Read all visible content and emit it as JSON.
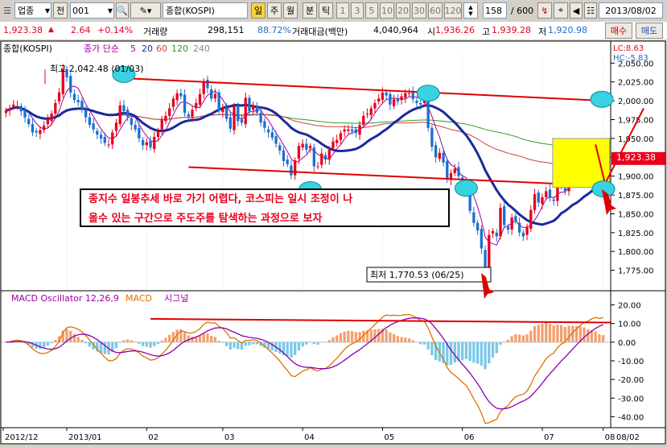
{
  "toolbar": {
    "market_label": "업종",
    "prev_label": "전",
    "code": "001",
    "index_name": "종합(KOSPI)",
    "period_buttons": [
      "일",
      "주",
      "월",
      "분",
      "틱"
    ],
    "minute_buttons": [
      "1",
      "3",
      "5",
      "10",
      "20",
      "30",
      "60",
      "120"
    ],
    "count": "158",
    "count_total": "/ 600",
    "date": "2013/08/02"
  },
  "quote": {
    "price": "1,923.38",
    "change": "2.64",
    "change_pct": "+0.14%",
    "volume_label": "거래량",
    "volume": "298,151",
    "volume_pct": "88.72%",
    "amount_label": "거래대금(백만)",
    "amount": "4,040,964",
    "open_label": "시",
    "open": "1,936.26",
    "high_label": "고",
    "high": "1,939.28",
    "low_label": "저",
    "low": "1,920.98",
    "buy_label": "매수",
    "sell_label": "매도"
  },
  "colors": {
    "up": "#e8001c",
    "down": "#1b6fd0",
    "ma5": "#a000a0",
    "ma20": "#1a2a9a",
    "ma60": "#d04040",
    "ma120": "#2e9a2e",
    "ma240": "#8a8a8a",
    "highlight": "#ffff00",
    "ellipse": "#39d2e0"
  },
  "chart_data": [
    {
      "type": "candlestick",
      "title": "종합(KOSPI)",
      "legend": [
        "종가 단순",
        "5",
        "20",
        "60",
        "120",
        "240"
      ],
      "right_labels": {
        "lc": "LC:8.63",
        "hc": "HC:-5.83"
      },
      "ylim": [
        1750,
        2060
      ],
      "y_ticks": [
        1775,
        1800,
        1825,
        1850,
        1875,
        1900,
        1925,
        1950,
        1975,
        2000,
        2025,
        2050
      ],
      "x_ticks": [
        "2012/12",
        "2013/01",
        "02",
        "03",
        "04",
        "05",
        "06",
        "07",
        "08"
      ],
      "x_axis_end_label": "08/02",
      "last_price_label": "1,923.38",
      "annotations": {
        "high": "최고 2,042.48 (01/03)",
        "low": "최저 1,770.53 (06/25)",
        "comment_line1": "종지수 일봉추세 바로 가기 어렵다, 코스피는 일시 조정이 나",
        "comment_line2": "올수 있는 구간으로 주도주를 탐색하는 과정으로 보자"
      },
      "close": [
        1987,
        1990,
        1995,
        1993,
        1986,
        1978,
        1969,
        1958,
        1958,
        1961,
        1967,
        1975,
        1983,
        1997,
        2011,
        2042,
        2031,
        2011,
        2001,
        1998,
        1990,
        1978,
        1968,
        1962,
        1955,
        1950,
        1944,
        1942,
        1958,
        1971,
        1994,
        1986,
        1979,
        1968,
        1962,
        1950,
        1941,
        1945,
        1938,
        1952,
        1960,
        1975,
        1980,
        1990,
        2003,
        2010,
        2006,
        1984,
        1979,
        1988,
        1997,
        2009,
        2026,
        2017,
        2003,
        2009,
        1987,
        1991,
        1976,
        1963,
        1993,
        1973,
        1971,
        2004,
        1986,
        1994,
        1984,
        1971,
        1964,
        1958,
        1951,
        1943,
        1934,
        1920,
        1916,
        1901,
        1921,
        1940,
        1943,
        1935,
        1940,
        1913,
        1913,
        1930,
        1922,
        1935,
        1946,
        1948,
        1957,
        1962,
        1962,
        1960,
        1957,
        1968,
        1980,
        1983,
        1990,
        1997,
        2003,
        2011,
        2007,
        1995,
        2002,
        1999,
        2006,
        2010,
        2010,
        2002,
        1997,
        1995,
        2001,
        1964,
        1939,
        1925,
        1931,
        1918,
        1897,
        1904,
        1910,
        1900,
        1890,
        1886,
        1854,
        1838,
        1828,
        1804,
        1770,
        1822,
        1827,
        1820,
        1858,
        1835,
        1829,
        1845,
        1840,
        1825,
        1820,
        1832,
        1855,
        1876,
        1865,
        1872,
        1880,
        1871,
        1867,
        1890,
        1886,
        1880,
        1906,
        1905,
        1910,
        1915,
        1916,
        1912,
        1922,
        1921,
        1909,
        1923
      ],
      "ma_visible_periods": [
        "5",
        "20",
        "60",
        "120"
      ]
    },
    {
      "type": "bar+line",
      "title": "MACD Oscillator 12,26,9",
      "legend": [
        "MACD Oscillator 12,26,9",
        "MACD",
        "시그널"
      ],
      "ylim": [
        -45,
        25
      ],
      "y_ticks": [
        -40,
        -30,
        -20,
        -10,
        0,
        10,
        20
      ],
      "x_ticks": [
        "2012/12",
        "2013/01",
        "02",
        "03",
        "04",
        "05",
        "06",
        "07",
        "08"
      ],
      "x_axis_end_label": "08/02",
      "series": [
        {
          "name": "MACD Oscillator 12,26,9"
        },
        {
          "name": "MACD"
        },
        {
          "name": "시그널"
        }
      ]
    }
  ]
}
